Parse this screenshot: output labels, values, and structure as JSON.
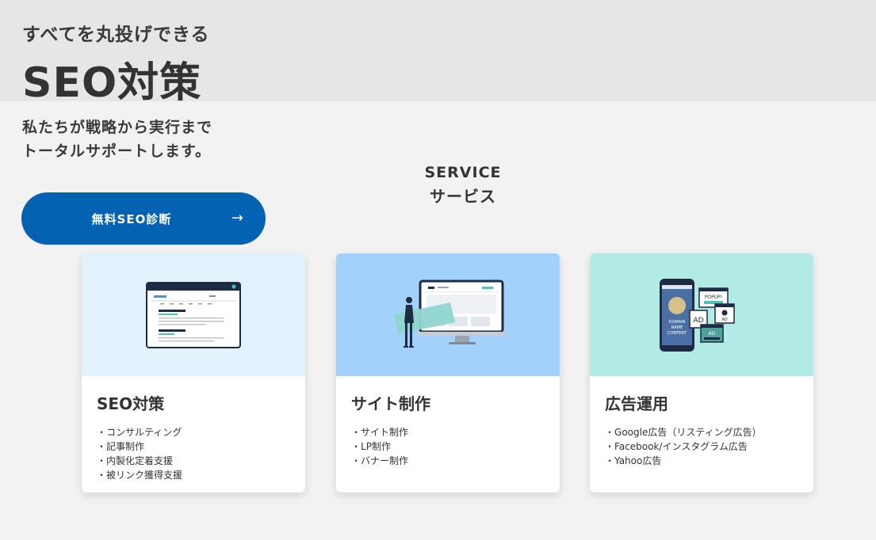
{
  "hero": {
    "eyebrow": "すべてを丸投げできる",
    "title": "SEO対策",
    "lead_line1": "私たちが戦略から実行まで",
    "lead_line2": "トータルサポートします。",
    "cta_label": "無料SEO診断",
    "cta_arrow": "→"
  },
  "section": {
    "title_en": "SERVICE",
    "title_ja": "サービス"
  },
  "services": [
    {
      "title": "SEO対策",
      "image_bg": "#e1f2fc",
      "items": [
        "コンサルティング",
        "記事制作",
        "内製化定着支援",
        "被リンク獲得支援"
      ]
    },
    {
      "title": "サイト制作",
      "image_bg": "#a2d2fc",
      "items": [
        "サイト制作",
        "LP制作",
        "バナー制作"
      ]
    },
    {
      "title": "広告運用",
      "image_bg": "#b2eae5",
      "items": [
        "Google広告（リスティング広告）",
        "Facebook/インスタグラム広告",
        "Yahoo広告"
      ]
    }
  ],
  "illustrations": {
    "ad_popup": "POPUP!",
    "ad_label": "AD",
    "phone_text1": "DOMAIN",
    "phone_text2": "NAME",
    "phone_text3": "CONTENT"
  },
  "colors": {
    "cta": "#0462b3",
    "page_bg": "#f2f2f2",
    "hero_band": "#e6e6e6"
  }
}
